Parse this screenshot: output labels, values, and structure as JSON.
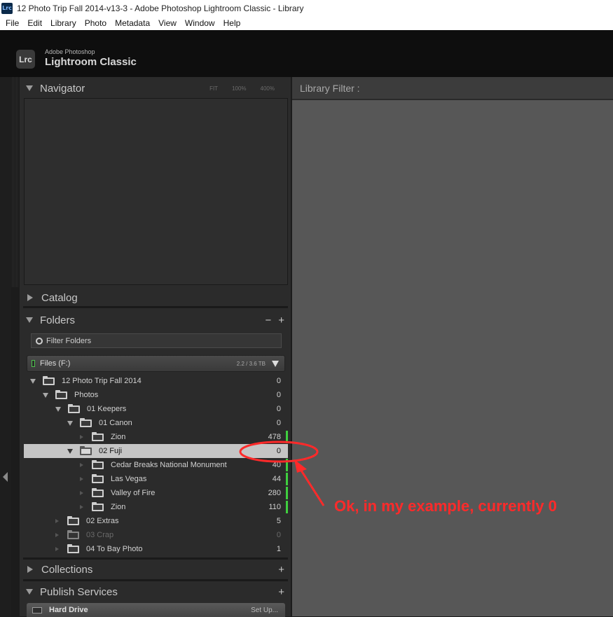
{
  "window": {
    "title": "12 Photo Trip Fall 2014-v13-3 - Adobe Photoshop Lightroom Classic - Library",
    "app_icon": "Lrc"
  },
  "menu": [
    "File",
    "Edit",
    "Library",
    "Photo",
    "Metadata",
    "View",
    "Window",
    "Help"
  ],
  "identity": {
    "badge": "Lrc",
    "line1": "Adobe Photoshop",
    "line2": "Lightroom Classic"
  },
  "navigator": {
    "label": "Navigator",
    "zoom": [
      "FIT",
      "100%",
      "400%"
    ]
  },
  "catalog": {
    "label": "Catalog"
  },
  "folders": {
    "label": "Folders",
    "minus": "−",
    "plus": "+",
    "filter_placeholder": "Filter Folders",
    "volume": {
      "name": "Files (F:)",
      "size": "2.2 / 3.6 TB"
    },
    "rows": [
      {
        "name": "12 Photo Trip Fall 2014",
        "count": "0"
      },
      {
        "name": "Photos",
        "count": "0"
      },
      {
        "name": "01 Keepers",
        "count": "0"
      },
      {
        "name": "01 Canon",
        "count": "0"
      },
      {
        "name": "Zion",
        "count": "478"
      },
      {
        "name": "02 Fuji",
        "count": "0"
      },
      {
        "name": "Cedar Breaks National Monument",
        "count": "40"
      },
      {
        "name": "Las Vegas",
        "count": "44"
      },
      {
        "name": "Valley of Fire",
        "count": "280"
      },
      {
        "name": "Zion",
        "count": "110"
      },
      {
        "name": "02 Extras",
        "count": "5"
      },
      {
        "name": "03 Crap",
        "count": "0"
      },
      {
        "name": "04 To Bay Photo",
        "count": "1"
      }
    ]
  },
  "collections": {
    "label": "Collections",
    "plus": "+"
  },
  "publish": {
    "label": "Publish Services",
    "plus": "+",
    "item": "Hard Drive",
    "setup": "Set Up..."
  },
  "library_filter": {
    "label": "Library Filter :"
  },
  "annotation": {
    "text": "Ok, in my example, currently 0",
    "color": "#ff2a2a"
  },
  "colors": {
    "accent_green": "#3fcf3f",
    "selection": "#c5c5c5"
  }
}
